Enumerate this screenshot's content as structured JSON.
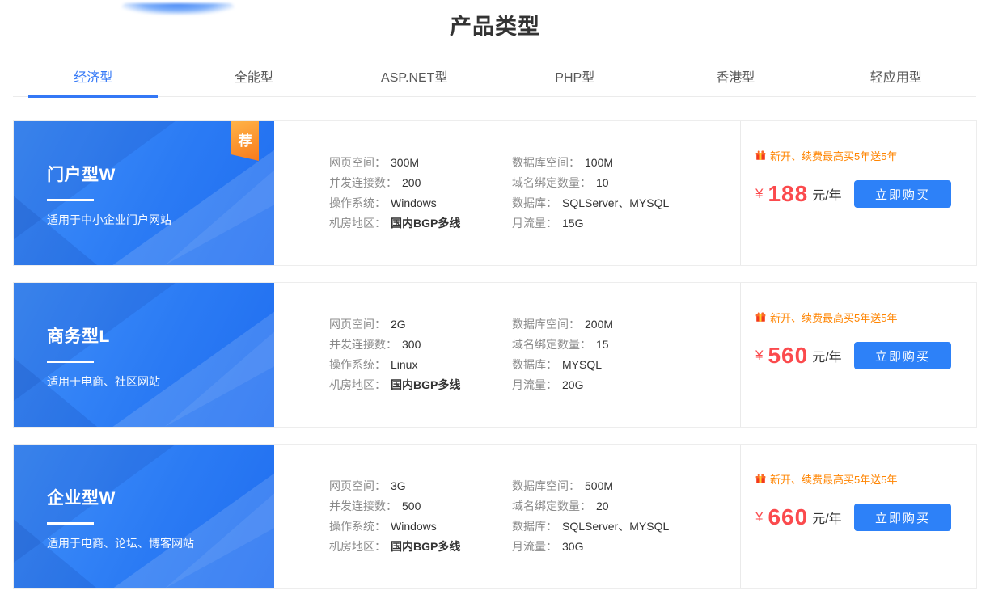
{
  "header": {
    "title": "产品类型"
  },
  "tabs": [
    {
      "label": "经济型",
      "active": true
    },
    {
      "label": "全能型",
      "active": false
    },
    {
      "label": "ASP.NET型",
      "active": false
    },
    {
      "label": "PHP型",
      "active": false
    },
    {
      "label": "香港型",
      "active": false
    },
    {
      "label": "轻应用型",
      "active": false
    }
  ],
  "cards": [
    {
      "name": "门户型W",
      "description": "适用于中小企业门户网站",
      "badge": "荐",
      "specs_left": [
        {
          "label": "网页空间：",
          "value": "300M"
        },
        {
          "label": "并发连接数：",
          "value": "200"
        },
        {
          "label": "操作系统：",
          "value": "Windows"
        },
        {
          "label": "机房地区：",
          "value": "国内BGP多线"
        }
      ],
      "specs_right": [
        {
          "label": "数据库空间：",
          "value": "100M"
        },
        {
          "label": "域名绑定数量：",
          "value": "10"
        },
        {
          "label": "数据库：",
          "value": "SQLServer、MYSQL"
        },
        {
          "label": "月流量：",
          "value": "15G"
        }
      ],
      "promo": "新开、续费最高买5年送5年",
      "currency": "¥",
      "price": "188",
      "unit": "元/年",
      "buy_label": "立即购买"
    },
    {
      "name": "商务型L",
      "description": "适用于电商、社区网站",
      "badge": "",
      "specs_left": [
        {
          "label": "网页空间：",
          "value": "2G"
        },
        {
          "label": "并发连接数：",
          "value": "300"
        },
        {
          "label": "操作系统：",
          "value": "Linux"
        },
        {
          "label": "机房地区：",
          "value": "国内BGP多线"
        }
      ],
      "specs_right": [
        {
          "label": "数据库空间：",
          "value": "200M"
        },
        {
          "label": "域名绑定数量：",
          "value": "15"
        },
        {
          "label": "数据库：",
          "value": "MYSQL"
        },
        {
          "label": "月流量：",
          "value": "20G"
        }
      ],
      "promo": "新开、续费最高买5年送5年",
      "currency": "¥",
      "price": "560",
      "unit": "元/年",
      "buy_label": "立即购买"
    },
    {
      "name": "企业型W",
      "description": "适用于电商、论坛、博客网站",
      "badge": "",
      "specs_left": [
        {
          "label": "网页空间：",
          "value": "3G"
        },
        {
          "label": "并发连接数：",
          "value": "500"
        },
        {
          "label": "操作系统：",
          "value": "Windows"
        },
        {
          "label": "机房地区：",
          "value": "国内BGP多线"
        }
      ],
      "specs_right": [
        {
          "label": "数据库空间：",
          "value": "500M"
        },
        {
          "label": "域名绑定数量：",
          "value": "20"
        },
        {
          "label": "数据库：",
          "value": "SQLServer、MYSQL"
        },
        {
          "label": "月流量：",
          "value": "30G"
        }
      ],
      "promo": "新开、续费最高买5年送5年",
      "currency": "¥",
      "price": "660",
      "unit": "元/年",
      "buy_label": "立即购买"
    }
  ],
  "colors": {
    "accent_blue": "#2d81f8",
    "tab_active_blue": "#3478f6",
    "price_red": "#fb4a4d",
    "promo_orange": "#ff8400",
    "badge_orange": "#f87a1b",
    "banner_blue": "#2b7bf4"
  }
}
